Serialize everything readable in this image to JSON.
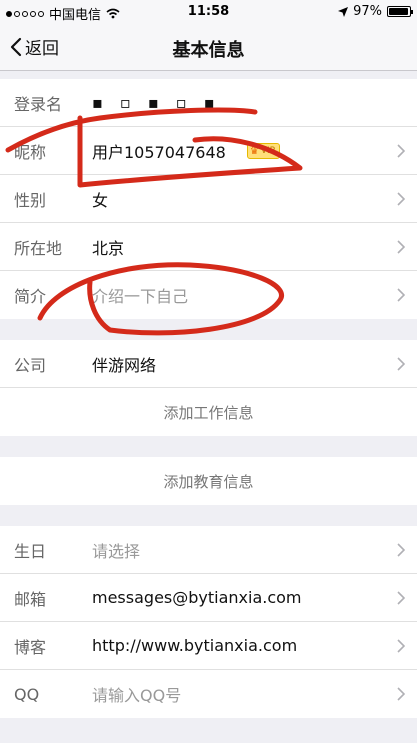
{
  "status_bar": {
    "carrier": "中国电信",
    "time": "11:58",
    "battery_percent": "97%",
    "battery_level": 0.97
  },
  "nav": {
    "back_label": "返回",
    "title": "基本信息"
  },
  "profile": {
    "login_name": {
      "label": "登录名",
      "value": ""
    },
    "nickname": {
      "label": "昵称",
      "value": "用户1057047648",
      "badge": "VIP"
    },
    "gender": {
      "label": "性别",
      "value": "女"
    },
    "location": {
      "label": "所在地",
      "value": "北京"
    },
    "intro": {
      "label": "简介",
      "placeholder": "介绍一下自己"
    }
  },
  "work": {
    "company": {
      "label": "公司",
      "value": "伴游网络"
    },
    "add_work": "添加工作信息"
  },
  "education": {
    "add_education": "添加教育信息"
  },
  "contact": {
    "birthday": {
      "label": "生日",
      "placeholder": "请选择"
    },
    "email": {
      "label": "邮箱",
      "value": "messages@bytianxia.com"
    },
    "blog": {
      "label": "博客",
      "value": "http://www.bytianxia.com"
    },
    "qq": {
      "label": "QQ",
      "placeholder": "请输入QQ号"
    }
  },
  "colors": {
    "background": "#efeff4",
    "scribble": "#d42a1a",
    "chevron": "#b0b0b5"
  }
}
